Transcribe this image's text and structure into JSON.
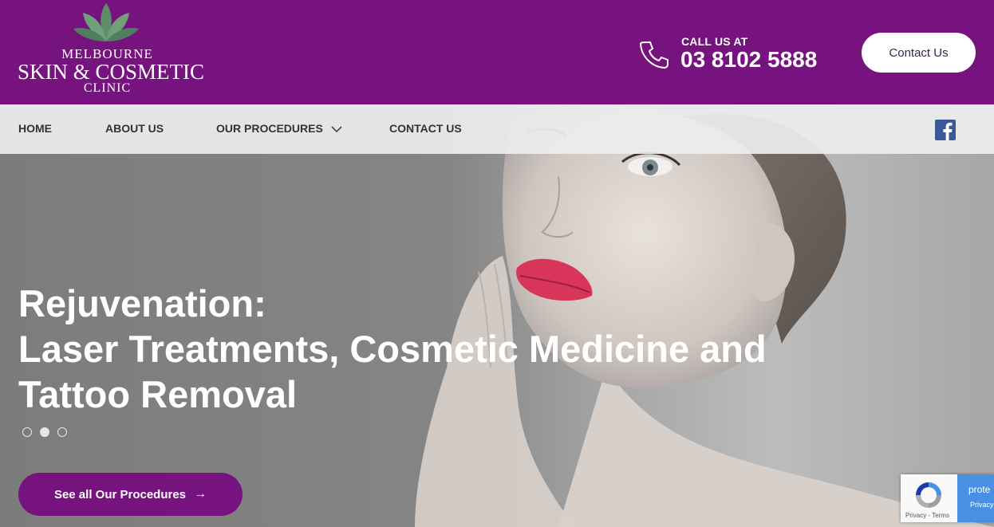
{
  "brand": {
    "line1": "MELBOURNE",
    "line2": "SKIN & COSMETIC",
    "line3": "CLINIC",
    "color": "#76137f"
  },
  "header": {
    "call_label": "CALL US AT",
    "phone": "03 8102 5888",
    "contact_button": "Contact Us",
    "phone_icon": "phone-icon"
  },
  "nav": {
    "items": [
      {
        "label": "HOME"
      },
      {
        "label": "ABOUT US"
      },
      {
        "label": "OUR PROCEDURES",
        "has_dropdown": true
      },
      {
        "label": "CONTACT US"
      }
    ],
    "social_icon": "facebook-icon"
  },
  "hero": {
    "title_lines": [
      "Rejuvenation:",
      "Laser Treatments, Cosmetic Medicine and",
      "Tattoo Removal"
    ],
    "slides_total": 3,
    "active_slide": 2,
    "cta_label": "See all Our Procedures",
    "cta_arrow": "→"
  },
  "recaptcha": {
    "links": "Privacy - Terms",
    "side_top": "prote",
    "side_bottom": "Privacy"
  }
}
